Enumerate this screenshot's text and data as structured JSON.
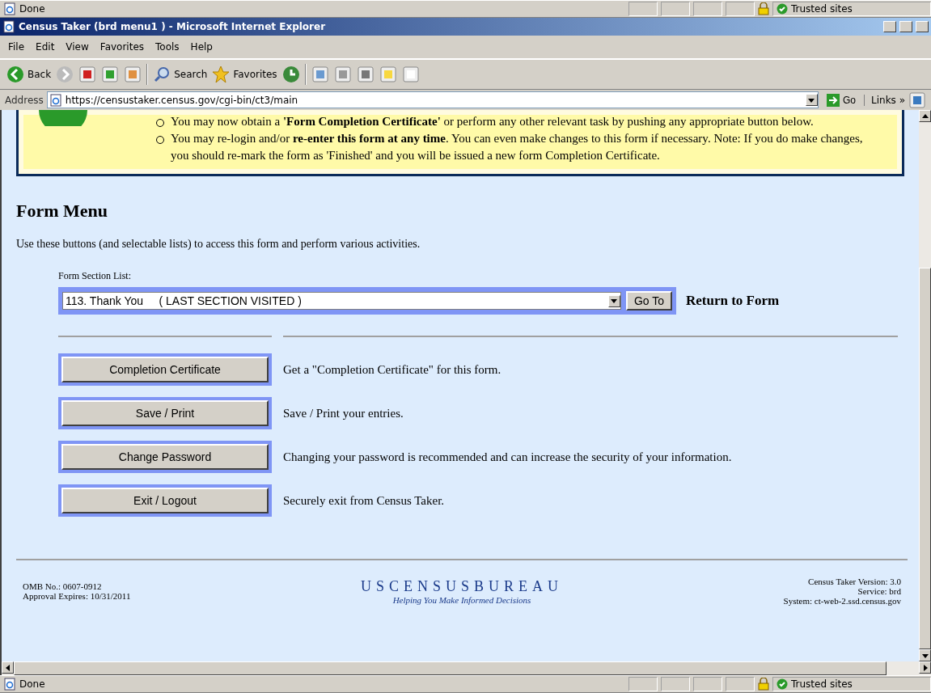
{
  "top_status_bar": {
    "text": "Done",
    "zone": "Trusted sites"
  },
  "window": {
    "title": "Census Taker (brd menu1 ) - Microsoft Internet Explorer"
  },
  "menu": [
    "File",
    "Edit",
    "View",
    "Favorites",
    "Tools",
    "Help"
  ],
  "toolbar": {
    "back": "Back",
    "search": "Search",
    "favorites": "Favorites"
  },
  "address": {
    "label": "Address",
    "url": "https://censustaker.census.gov/cgi-bin/ct3/main",
    "go": "Go",
    "links": "Links",
    "more": "»"
  },
  "notice": [
    "You may now obtain a **'Form Completion Certificate'** or perform any other relevant task by pushing any appropriate button below.",
    "You may re-login and/or **re-enter this form at any time**. You can even make changes to this form if necessary. Note: If you do make changes, you should re-mark the form as 'Finished' and you will be issued a new form Completion Certificate."
  ],
  "form_menu": {
    "heading": "Form Menu",
    "intro": "Use these buttons (and selectable lists) to access this form and perform various activities.",
    "section_label": "Form Section List:",
    "section_value": "113. Thank You     ( LAST SECTION VISITED )",
    "go_to": "Go To",
    "return": "Return to Form",
    "actions": [
      {
        "button": "Completion Certificate",
        "description": "Get a \"Completion Certificate\" for this form."
      },
      {
        "button": "Save / Print",
        "description": "Save / Print your entries."
      },
      {
        "button": "Change Password",
        "description": "Changing your password is recommended and can increase the security of your information."
      },
      {
        "button": "Exit / Logout",
        "description": "Securely exit from Census Taker."
      }
    ]
  },
  "footer": {
    "omb": "OMB No.: 0607-0912",
    "approval": "Approval Expires: 10/31/2011",
    "logo": "USCENSUSBUREAU",
    "tagline": "Helping You Make Informed Decisions",
    "version": "Census Taker Version: 3.0",
    "service": "Service: brd",
    "system": "System: ct-web-2.ssd.census.gov"
  },
  "status_bar": {
    "text": "Done",
    "zone": "Trusted sites"
  }
}
